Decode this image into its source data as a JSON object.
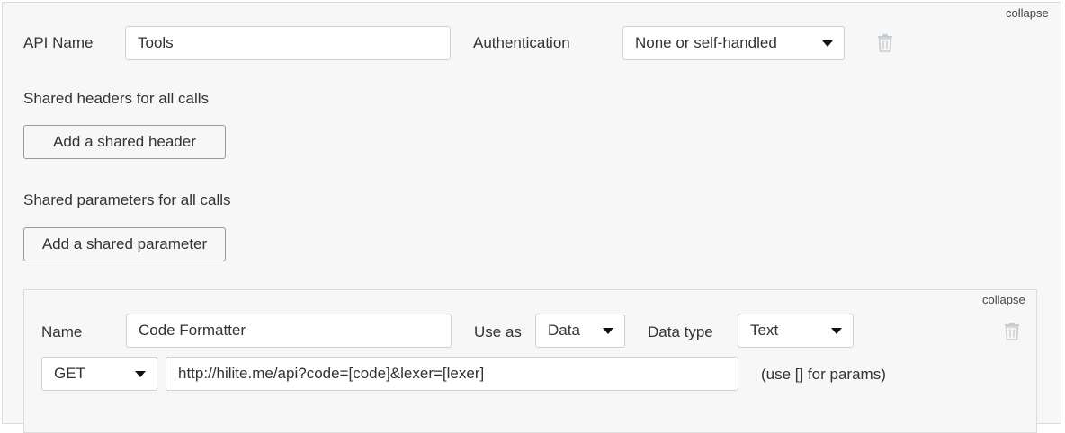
{
  "api": {
    "collapse_label": "collapse",
    "name_label": "API Name",
    "name_value": "Tools",
    "auth_label": "Authentication",
    "auth_value": "None or self-handled",
    "headers_title": "Shared headers for all calls",
    "add_header_label": "Add a shared header",
    "params_title": "Shared parameters for all calls",
    "add_param_label": "Add a shared parameter"
  },
  "call": {
    "collapse_label": "collapse",
    "name_label": "Name",
    "name_value": "Code Formatter",
    "use_as_label": "Use as",
    "use_as_value": "Data",
    "data_type_label": "Data type",
    "data_type_value": "Text",
    "method_value": "GET",
    "url_value": "http://hilite.me/api?code=[code]&lexer=[lexer]",
    "url_hint": "(use [] for params)"
  },
  "icons": {
    "delete_api": "trash-icon",
    "delete_call": "trash-icon",
    "dropdown": "caret-down-icon"
  },
  "colors": {
    "panel_bg": "#f7f7f7",
    "border": "#dcdcdc",
    "trash": "#c8cdd2"
  }
}
